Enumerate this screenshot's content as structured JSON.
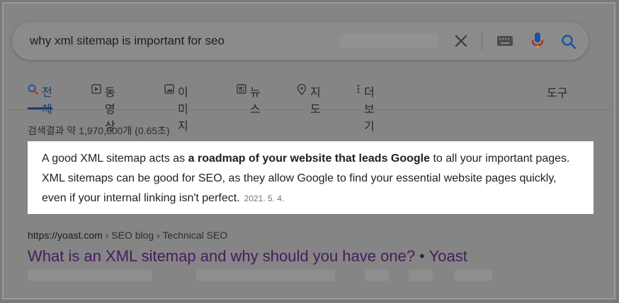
{
  "search": {
    "query": "why xml sitemap is important for seo"
  },
  "tabs": [
    {
      "label": "전체",
      "icon": "search-icon",
      "active": true
    },
    {
      "label": "동영상",
      "icon": "video-icon"
    },
    {
      "label": "이미지",
      "icon": "image-icon"
    },
    {
      "label": "뉴스",
      "icon": "news-icon"
    },
    {
      "label": "지도",
      "icon": "map-pin-icon"
    },
    {
      "label": "더보기",
      "icon": "more-vert-icon"
    }
  ],
  "tools_label": "도구",
  "stats": "검색결과 약 1,970,000개 (0.65초)",
  "snippet": {
    "text_before": "A good XML sitemap acts as ",
    "text_bold": "a roadmap of your website that leads Google",
    "text_after": " to all your important pages. XML sitemaps can be good for SEO, as they allow Google to find your essential website pages quickly, even if your internal linking isn't perfect.",
    "date": "2021. 5. 4."
  },
  "result": {
    "domain": "https://yoast.com",
    "sep": "›",
    "crumb1": "SEO blog",
    "crumb2": "Technical SEO",
    "title": "What is an XML sitemap and why should you have one? • Yoast"
  },
  "colors": {
    "accent": "#1a3d6e",
    "visited_link": "#4a1a5e",
    "mic_blue": "#1a53a3",
    "mic_red": "#b02a25",
    "mic_yellow": "#c9a520"
  }
}
